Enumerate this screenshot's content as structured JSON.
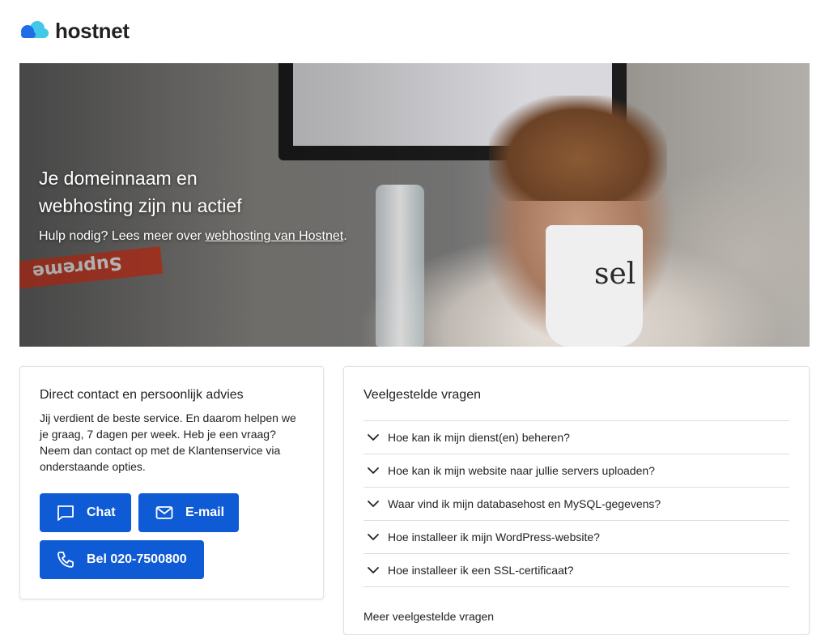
{
  "logo": {
    "text": "hostnet"
  },
  "hero": {
    "title_line1": "Je domeinnaam en",
    "title_line2": "webhosting zijn nu actief",
    "sub_prefix": "Hulp nodig? Lees meer over ",
    "sub_link": "webhosting van Hostnet",
    "sub_suffix": "."
  },
  "contact": {
    "title": "Direct contact en persoonlijk advies",
    "text": "Jij verdient de beste service. En daarom helpen we je graag, 7 dagen per week. Heb je een vraag? Neem dan contact op met de Klantenservice via onderstaande opties.",
    "buttons": {
      "chat": "Chat",
      "email": "E-mail",
      "call": "Bel 020-7500800"
    }
  },
  "faq": {
    "title": "Veelgestelde vragen",
    "items": [
      "Hoe kan ik mijn dienst(en) beheren?",
      "Hoe kan ik mijn website naar jullie servers uploaden?",
      "Waar vind ik mijn databasehost en MySQL-gegevens?",
      "Hoe installeer ik mijn WordPress-website?",
      "Hoe installeer ik een SSL-certificaat?"
    ],
    "more": "Meer veelgestelde vragen"
  },
  "colors": {
    "brand_blue": "#0f5bd6",
    "logo_light": "#44c8e8",
    "logo_dark": "#1e6fe6"
  },
  "icons": {
    "logo": "cloud-icon",
    "chat": "chat-bubble-icon",
    "email": "envelope-icon",
    "call": "phone-icon",
    "faq": "chevron-down-icon"
  }
}
